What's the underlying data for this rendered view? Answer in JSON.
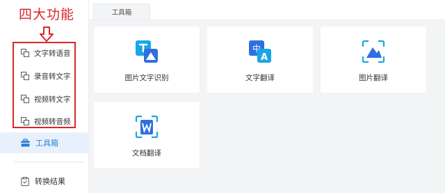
{
  "annotation": {
    "title": "四大功能"
  },
  "sidebar": {
    "items": [
      {
        "label": "文字转语音"
      },
      {
        "label": "录音转文字"
      },
      {
        "label": "视频转文字"
      },
      {
        "label": "视频转音频"
      }
    ],
    "active": {
      "label": "工具箱"
    },
    "bottom": {
      "label": "转换结果"
    }
  },
  "main": {
    "tab": {
      "label": "工具箱"
    },
    "cards": [
      {
        "label": "图片文字识别",
        "icon": "image-text-ocr-icon"
      },
      {
        "label": "文字翻译",
        "icon": "text-translate-icon"
      },
      {
        "label": "图片翻译",
        "icon": "image-translate-icon"
      },
      {
        "label": "文档翻译",
        "icon": "document-translate-icon"
      }
    ]
  },
  "colors": {
    "accent": "#2f7fe0",
    "annotation_red": "#d9262c",
    "active_bg": "#e8f1fb",
    "main_bg": "#f3f4f6"
  }
}
